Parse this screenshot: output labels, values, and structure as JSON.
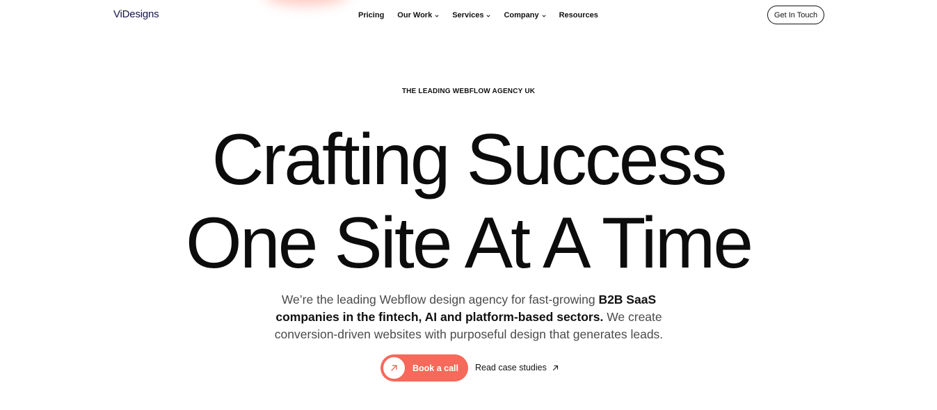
{
  "brand": {
    "logo": "ViDesigns",
    "accent_color": "#f7695a",
    "logo_color": "#15134a"
  },
  "nav": {
    "items": [
      {
        "label": "Pricing",
        "has_dropdown": false
      },
      {
        "label": "Our Work",
        "has_dropdown": true
      },
      {
        "label": "Services",
        "has_dropdown": true
      },
      {
        "label": "Company",
        "has_dropdown": true
      },
      {
        "label": "Resources",
        "has_dropdown": false
      }
    ],
    "cta_label": "Get In Touch"
  },
  "hero": {
    "eyebrow": "THE LEADING WEBFLOW AGENCY UK",
    "title_line1": "Crafting Success",
    "title_line2": "One Site At A Time",
    "sub_part1": "We’re the leading Webflow design agency for fast-growing ",
    "sub_bold": "B2B SaaS companies in the fintech, AI and platform-based sectors.",
    "sub_part2": " We create conversion-driven websites with purposeful design that generates leads.",
    "primary_cta": "Book a call",
    "secondary_cta": "Read case studies",
    "icons": {
      "primary_cta_icon": "arrow-up-right-icon",
      "secondary_cta_icon": "arrow-up-right-icon",
      "dropdown_icon": "chevron-down-icon"
    }
  }
}
